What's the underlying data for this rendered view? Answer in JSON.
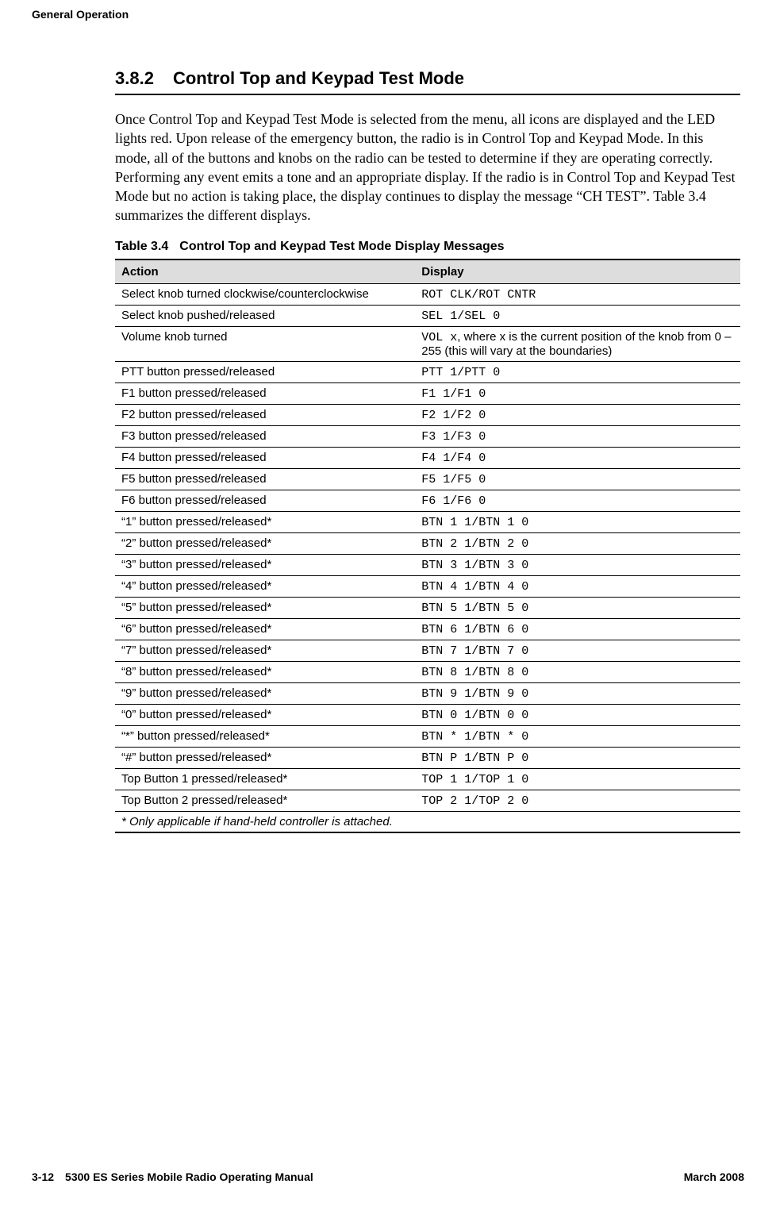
{
  "running_head": "General Operation",
  "section": {
    "number": "3.8.2",
    "title": "Control Top and Keypad Test Mode"
  },
  "paragraph": "Once Control Top and Keypad Test Mode is selected from the menu, all icons are displayed and the LED lights red. Upon release of the emergency button, the radio is in Control Top and Keypad Mode. In this mode, all of the buttons and knobs on the radio can be tested to determine if they are operating correctly. Performing any event emits a tone and an appropriate display. If the radio is in Control Top and Keypad Test Mode but no action is taking place, the display continues to display the message “CH TEST”. Table 3.4 summarizes the different displays.",
  "table": {
    "number": "Table 3.4",
    "title": "Control Top and Keypad Test Mode Display Messages",
    "headers": {
      "action": "Action",
      "display": "Display"
    },
    "rows": [
      {
        "action": "Select knob turned clockwise/counterclockwise",
        "display_mono": "ROT CLK/ROT CNTR",
        "display_note": ""
      },
      {
        "action": "Select knob pushed/released",
        "display_mono": "SEL 1/SEL 0",
        "display_note": ""
      },
      {
        "action": "Volume knob turned",
        "display_mono": "VOL x",
        "display_note": ", where x is the current position of the knob from 0 – 255 (this will vary at the boundaries)"
      },
      {
        "action": "PTT button pressed/released",
        "display_mono": "PTT 1/PTT 0",
        "display_note": ""
      },
      {
        "action": "F1 button pressed/released",
        "display_mono": "F1 1/F1 0",
        "display_note": ""
      },
      {
        "action": "F2 button pressed/released",
        "display_mono": "F2 1/F2 0",
        "display_note": ""
      },
      {
        "action": "F3 button pressed/released",
        "display_mono": "F3 1/F3 0",
        "display_note": ""
      },
      {
        "action": "F4 button pressed/released",
        "display_mono": "F4 1/F4 0",
        "display_note": ""
      },
      {
        "action": "F5 button pressed/released",
        "display_mono": "F5 1/F5 0",
        "display_note": ""
      },
      {
        "action": "F6 button pressed/released",
        "display_mono": "F6 1/F6 0",
        "display_note": ""
      },
      {
        "action": "“1” button pressed/released*",
        "display_mono": "BTN 1 1/BTN 1 0",
        "display_note": ""
      },
      {
        "action": "“2” button pressed/released*",
        "display_mono": "BTN 2 1/BTN 2 0",
        "display_note": ""
      },
      {
        "action": "“3” button pressed/released*",
        "display_mono": "BTN 3 1/BTN 3 0",
        "display_note": ""
      },
      {
        "action": "“4” button pressed/released*",
        "display_mono": "BTN 4 1/BTN 4 0",
        "display_note": ""
      },
      {
        "action": "“5” button pressed/released*",
        "display_mono": "BTN 5 1/BTN 5 0",
        "display_note": ""
      },
      {
        "action": "“6” button pressed/released*",
        "display_mono": "BTN 6 1/BTN 6 0",
        "display_note": ""
      },
      {
        "action": "“7” button pressed/released*",
        "display_mono": "BTN 7 1/BTN 7 0",
        "display_note": ""
      },
      {
        "action": "“8” button pressed/released*",
        "display_mono": "BTN 8 1/BTN 8 0",
        "display_note": ""
      },
      {
        "action": "“9” button pressed/released*",
        "display_mono": "BTN 9 1/BTN 9 0",
        "display_note": ""
      },
      {
        "action": "“0” button pressed/released*",
        "display_mono": "BTN 0 1/BTN 0 0",
        "display_note": ""
      },
      {
        "action": "“*” button pressed/released*",
        "display_mono": "BTN * 1/BTN * 0",
        "display_note": ""
      },
      {
        "action": "“#” button pressed/released*",
        "display_mono": "BTN P 1/BTN P 0",
        "display_note": ""
      },
      {
        "action": "Top Button 1 pressed/released*",
        "display_mono": "TOP 1 1/TOP 1 0",
        "display_note": ""
      },
      {
        "action": "Top Button 2 pressed/released*",
        "display_mono": "TOP 2 1/TOP 2 0",
        "display_note": ""
      }
    ],
    "footnote": "* Only applicable if hand-held controller is attached."
  },
  "footer": {
    "page": "3-12",
    "manual": "5300 ES Series Mobile Radio Operating Manual",
    "date": "March 2008"
  }
}
